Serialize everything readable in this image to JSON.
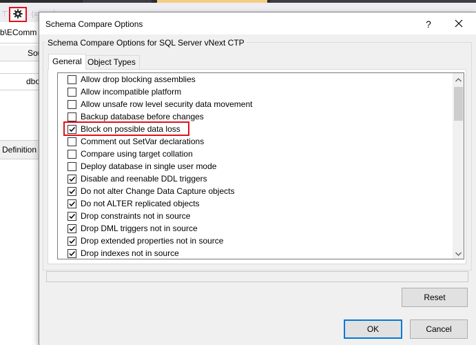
{
  "ide": {
    "path_text": "b\\EComm",
    "column_header": "Sou",
    "row_value": "dbo",
    "definition_tab": "Definition"
  },
  "dialog": {
    "title": "Schema Compare Options",
    "help_label": "?",
    "group_label": "Schema Compare Options for SQL Server vNext CTP",
    "tabs": [
      {
        "label": "General",
        "selected": true
      },
      {
        "label": "Object Types",
        "selected": false
      }
    ],
    "options": [
      {
        "label": "Allow drop blocking assemblies",
        "checked": false
      },
      {
        "label": "Allow incompatible platform",
        "checked": false
      },
      {
        "label": "Allow unsafe row level security data movement",
        "checked": false
      },
      {
        "label": "Backup database before changes",
        "checked": false
      },
      {
        "label": "Block on possible data loss",
        "checked": true,
        "highlighted": true
      },
      {
        "label": "Comment out SetVar declarations",
        "checked": false
      },
      {
        "label": "Compare using target collation",
        "checked": false
      },
      {
        "label": "Deploy database in single user mode",
        "checked": false
      },
      {
        "label": "Disable and reenable DDL triggers",
        "checked": true
      },
      {
        "label": "Do not alter Change Data Capture objects",
        "checked": true
      },
      {
        "label": "Do not ALTER replicated objects",
        "checked": true
      },
      {
        "label": "Drop constraints not in source",
        "checked": true
      },
      {
        "label": "Drop DML triggers not in source",
        "checked": true
      },
      {
        "label": "Drop extended properties not in source",
        "checked": true
      },
      {
        "label": "Drop indexes not in source",
        "checked": true
      }
    ],
    "buttons": {
      "reset": "Reset",
      "ok": "OK",
      "cancel": "Cancel"
    }
  },
  "colors": {
    "highlight": "#e0101a",
    "default_button_border": "#0078d7",
    "dialog_bg": "#f0f0f0"
  }
}
